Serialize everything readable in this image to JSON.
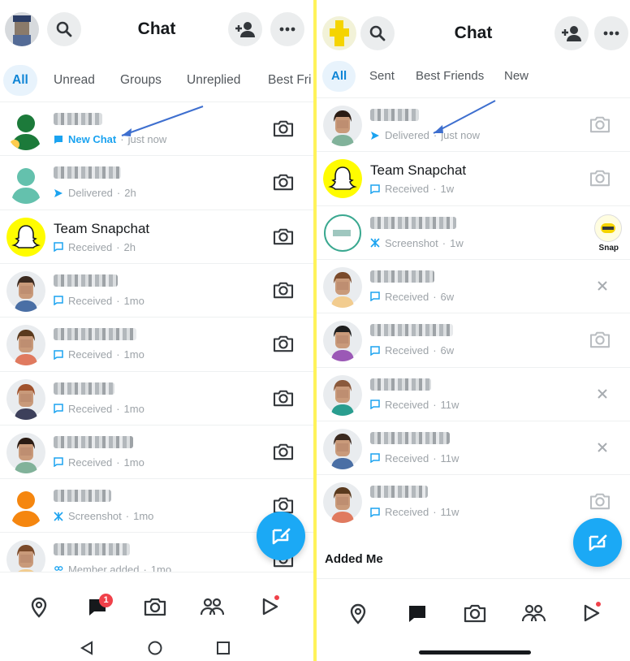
{
  "left": {
    "header": {
      "title": "Chat"
    },
    "tabs": [
      {
        "label": "All",
        "active": true
      },
      {
        "label": "Unread"
      },
      {
        "label": "Groups"
      },
      {
        "label": "Unreplied"
      },
      {
        "label": "Best Fri"
      }
    ],
    "rows": [
      {
        "name": "",
        "status_icon": "chat-icon",
        "status": "New Chat",
        "time": "just now",
        "highlight": true,
        "avatar": "silhouette-green",
        "action": "camera-icon"
      },
      {
        "name": "",
        "status_icon": "sent-arrow-icon",
        "status": "Delivered",
        "time": "2h",
        "avatar": "silhouette-teal",
        "action": "camera-icon"
      },
      {
        "name": "Team Snapchat",
        "status_icon": "received-chat-icon",
        "status": "Received",
        "time": "2h",
        "avatar": "snapchat-ghost",
        "action": "camera-icon"
      },
      {
        "name": "",
        "status_icon": "received-chat-icon",
        "status": "Received",
        "time": "1mo",
        "avatar": "bitmoji-1",
        "action": "camera-icon"
      },
      {
        "name": "",
        "status_icon": "received-chat-icon",
        "status": "Received",
        "time": "1mo",
        "avatar": "bitmoji-2",
        "action": "camera-icon"
      },
      {
        "name": "",
        "status_icon": "received-chat-icon",
        "status": "Received",
        "time": "1mo",
        "avatar": "bitmoji-3",
        "action": "camera-icon"
      },
      {
        "name": "",
        "status_icon": "received-chat-icon",
        "status": "Received",
        "time": "1mo",
        "avatar": "bitmoji-4",
        "action": "camera-icon"
      },
      {
        "name": "",
        "status_icon": "screenshot-icon",
        "status": "Screenshot",
        "time": "1mo",
        "avatar": "silhouette-orange",
        "action": "camera-icon"
      },
      {
        "name": "",
        "status_icon": "group-icon",
        "status": "Member added",
        "time": "1mo",
        "avatar": "bitmoji-5",
        "action": "camera-icon"
      }
    ],
    "nav_badge": "1"
  },
  "right": {
    "header": {
      "title": "Chat"
    },
    "tabs": [
      {
        "label": "All",
        "active": true
      },
      {
        "label": "Sent"
      },
      {
        "label": "Best Friends"
      },
      {
        "label": "New"
      }
    ],
    "rows": [
      {
        "name": "",
        "status_icon": "sent-arrow-icon",
        "status": "Delivered",
        "time": "just now",
        "avatar": "bitmoji-6",
        "action": "camera-icon"
      },
      {
        "name": "Team Snapchat",
        "status_icon": "received-chat-icon",
        "status": "Received",
        "time": "1w",
        "avatar": "snapchat-ghost",
        "action": "camera-icon"
      },
      {
        "name": "",
        "status_icon": "screenshot-icon",
        "status": "Screenshot",
        "time": "1w",
        "avatar": "initials-ring",
        "action": "snap",
        "action_label": "Snap"
      },
      {
        "name": "",
        "status_icon": "received-chat-icon",
        "status": "Received",
        "time": "6w",
        "avatar": "bitmoji-7",
        "action": "close-icon"
      },
      {
        "name": "",
        "status_icon": "received-chat-icon",
        "status": "Received",
        "time": "6w",
        "avatar": "bitmoji-8",
        "action": "camera-icon"
      },
      {
        "name": "",
        "status_icon": "received-chat-icon",
        "status": "Received",
        "time": "11w",
        "avatar": "bitmoji-9",
        "action": "close-icon"
      },
      {
        "name": "",
        "status_icon": "received-chat-icon",
        "status": "Received",
        "time": "11w",
        "avatar": "bitmoji-10",
        "action": "close-icon"
      },
      {
        "name": "",
        "status_icon": "received-chat-icon",
        "status": "Received",
        "time": "11w",
        "avatar": "bitmoji-11",
        "action": "camera-icon"
      }
    ],
    "section_added_me": "Added Me"
  },
  "colors": {
    "accent_blue": "#1ba9f5",
    "snap_yellow": "#fffc00",
    "notification_red": "#f0414a",
    "divider_yellow": "#fff35a"
  }
}
